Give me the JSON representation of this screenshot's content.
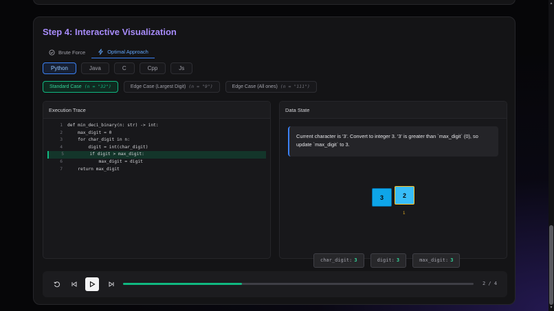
{
  "section": {
    "title": "Step 4: Interactive Visualization"
  },
  "approach_tabs": [
    {
      "label": "Brute Force",
      "icon": "check-circle-icon",
      "active": false
    },
    {
      "label": "Optimal Approach",
      "icon": "lightning-icon",
      "active": true
    }
  ],
  "languages": [
    "Python",
    "Java",
    "C",
    "Cpp",
    "Js"
  ],
  "active_language": "Python",
  "test_cases": [
    {
      "label": "Standard Case",
      "input": "(n = \"32\")",
      "active": true
    },
    {
      "label": "Edge Case (Largest Digit)",
      "input": "(n = \"9\")",
      "active": false
    },
    {
      "label": "Edge Case (All ones)",
      "input": "(n = \"111\")",
      "active": false
    }
  ],
  "trace_panel": {
    "title": "Execution Trace",
    "highlighted_line": 5,
    "lines": [
      {
        "n": "1",
        "text": "def min_deci_binary(n: str) -> int:"
      },
      {
        "n": "2",
        "text": "    max_digit = 0"
      },
      {
        "n": "3",
        "text": "    for char_digit in n:"
      },
      {
        "n": "4",
        "text": "        digit = int(char_digit)"
      },
      {
        "n": "5",
        "text": "        if digit > max_digit:"
      },
      {
        "n": "6",
        "text": "            max_digit = digit"
      },
      {
        "n": "7",
        "text": "    return max_digit"
      }
    ]
  },
  "data_panel": {
    "title": "Data State",
    "explanation": "Current character is '3'. Convert to integer 3. '3' is greater than `max_digit` (0), so update `max_digit` to 3.",
    "array": [
      "3",
      "2"
    ],
    "pointer_label": "i",
    "variables": [
      {
        "name": "char_digit:",
        "value": "3"
      },
      {
        "name": "digit:",
        "value": "3"
      },
      {
        "name": "max_digit:",
        "value": "3"
      }
    ]
  },
  "playback": {
    "step_text": "2 / 4",
    "progress": 0.34
  },
  "colors": {
    "accent_purple": "#a78bfa",
    "accent_green": "#10b981",
    "accent_blue": "#3b82f6",
    "array_cell": "#0ea5e9"
  }
}
